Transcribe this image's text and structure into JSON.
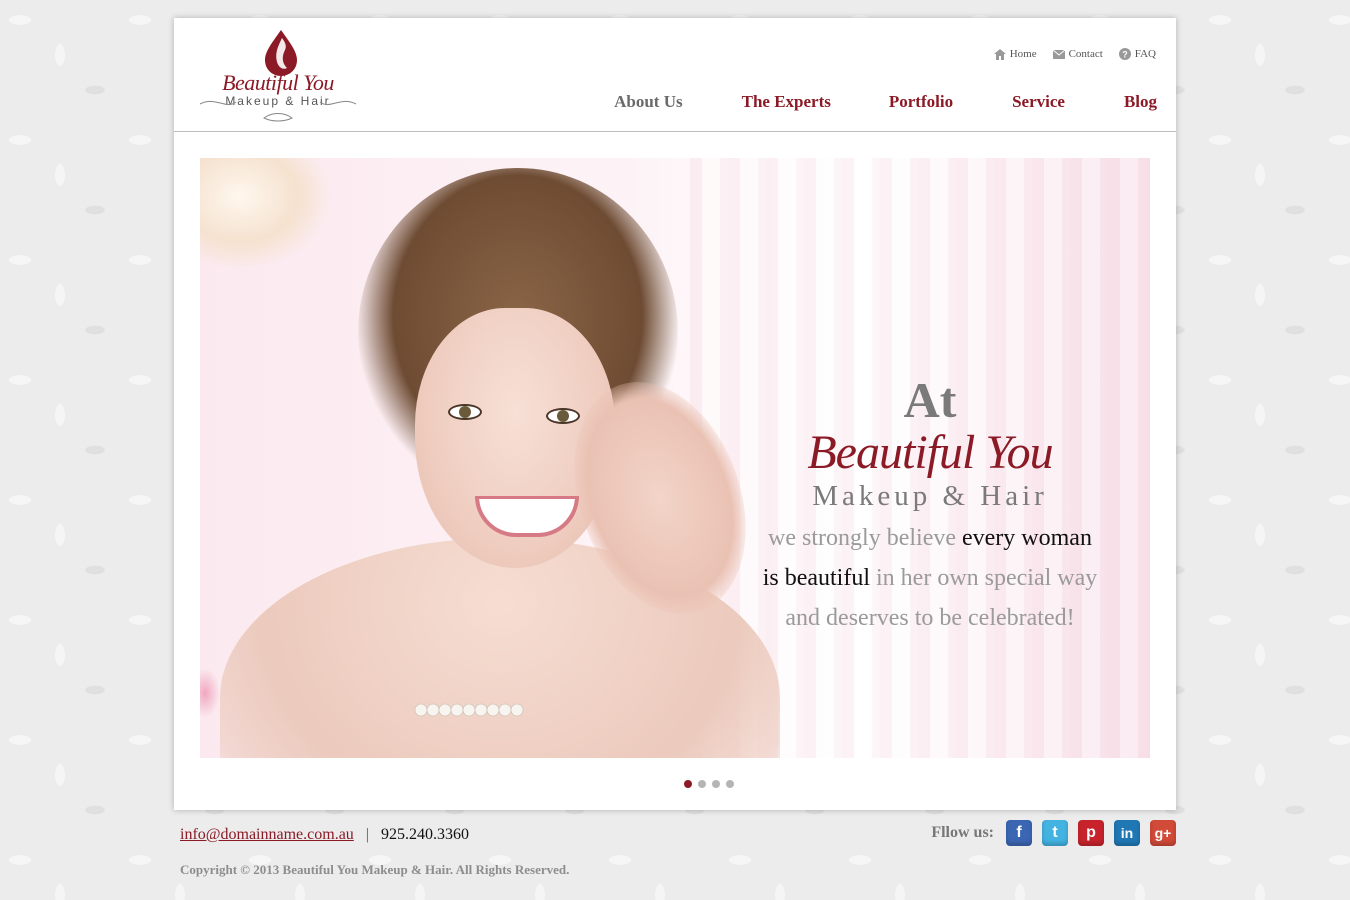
{
  "logo": {
    "title": "Beautiful You",
    "subtitle": "Makeup & Hair",
    "brand_color": "#8b1a26"
  },
  "utility_nav": [
    {
      "label": "Home",
      "icon": "home-icon"
    },
    {
      "label": "Contact",
      "icon": "envelope-icon"
    },
    {
      "label": "FAQ",
      "icon": "question-icon"
    }
  ],
  "main_nav": [
    {
      "label": "About Us",
      "active": true
    },
    {
      "label": "The Experts"
    },
    {
      "label": "Portfolio"
    },
    {
      "label": "Service"
    },
    {
      "label": "Blog"
    }
  ],
  "hero": {
    "at": "At",
    "brand": "Beautiful You",
    "sub": "Makeup & Hair",
    "line1_a": "we strongly believe ",
    "line1_b": "every woman",
    "line2_a": "is beautiful",
    "line2_b": " in her own special way",
    "line3": "and deserves to be celebrated!"
  },
  "slider": {
    "count": 4,
    "active_index": 0
  },
  "footer": {
    "email": "info@domainname.com.au",
    "separator": "|",
    "phone": "925.240.3360",
    "copyright": "Copyright © 2013 Beautiful You Makeup & Hair. All Rights Reserved.",
    "follow_label": "Fllow us:",
    "social": [
      {
        "name": "facebook-icon",
        "glyph": "f"
      },
      {
        "name": "twitter-icon",
        "glyph": "t"
      },
      {
        "name": "pinterest-icon",
        "glyph": "p"
      },
      {
        "name": "linkedin-icon",
        "glyph": "in"
      },
      {
        "name": "googleplus-icon",
        "glyph": "g+"
      }
    ]
  }
}
